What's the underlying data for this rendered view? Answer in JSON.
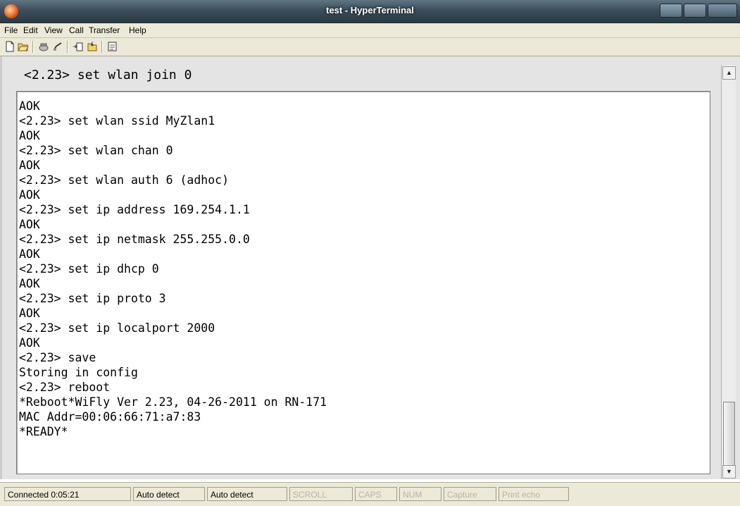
{
  "window": {
    "title": "test - HyperTerminal"
  },
  "menu": [
    "File",
    "Edit",
    "View",
    "Call",
    "Transfer",
    "Help"
  ],
  "toolbar": {
    "icons": [
      "new-icon",
      "open-icon",
      "call-icon",
      "disconnect-icon",
      "send-icon",
      "receive-icon",
      "properties-icon"
    ]
  },
  "terminal": {
    "first_line": "<2.23> set wlan join 0",
    "lines": [
      "AOK",
      "<2.23> set wlan ssid MyZlan1",
      "AOK",
      "<2.23> set wlan chan 0",
      "AOK",
      "<2.23> set wlan auth 6 (adhoc)",
      "AOK",
      "<2.23> set ip address 169.254.1.1",
      "AOK",
      "<2.23> set ip netmask 255.255.0.0",
      "AOK",
      "<2.23> set ip dhcp 0",
      "AOK",
      "<2.23> set ip proto 3",
      "AOK",
      "<2.23> set ip localport 2000",
      "AOK",
      "<2.23> save",
      "Storing in config",
      "<2.23> reboot",
      "*Reboot*WiFly Ver 2.23, 04-26-2011 on RN-171",
      "MAC Addr=00:06:66:71:a7:83",
      "*READY*"
    ]
  },
  "status": {
    "connected": "Connected 0:05:21",
    "detect1": "Auto detect",
    "detect2": "Auto detect",
    "scroll": "SCROLL",
    "caps": "CAPS",
    "num": "NUM",
    "capture": "Capture",
    "print_echo": "Print echo"
  }
}
